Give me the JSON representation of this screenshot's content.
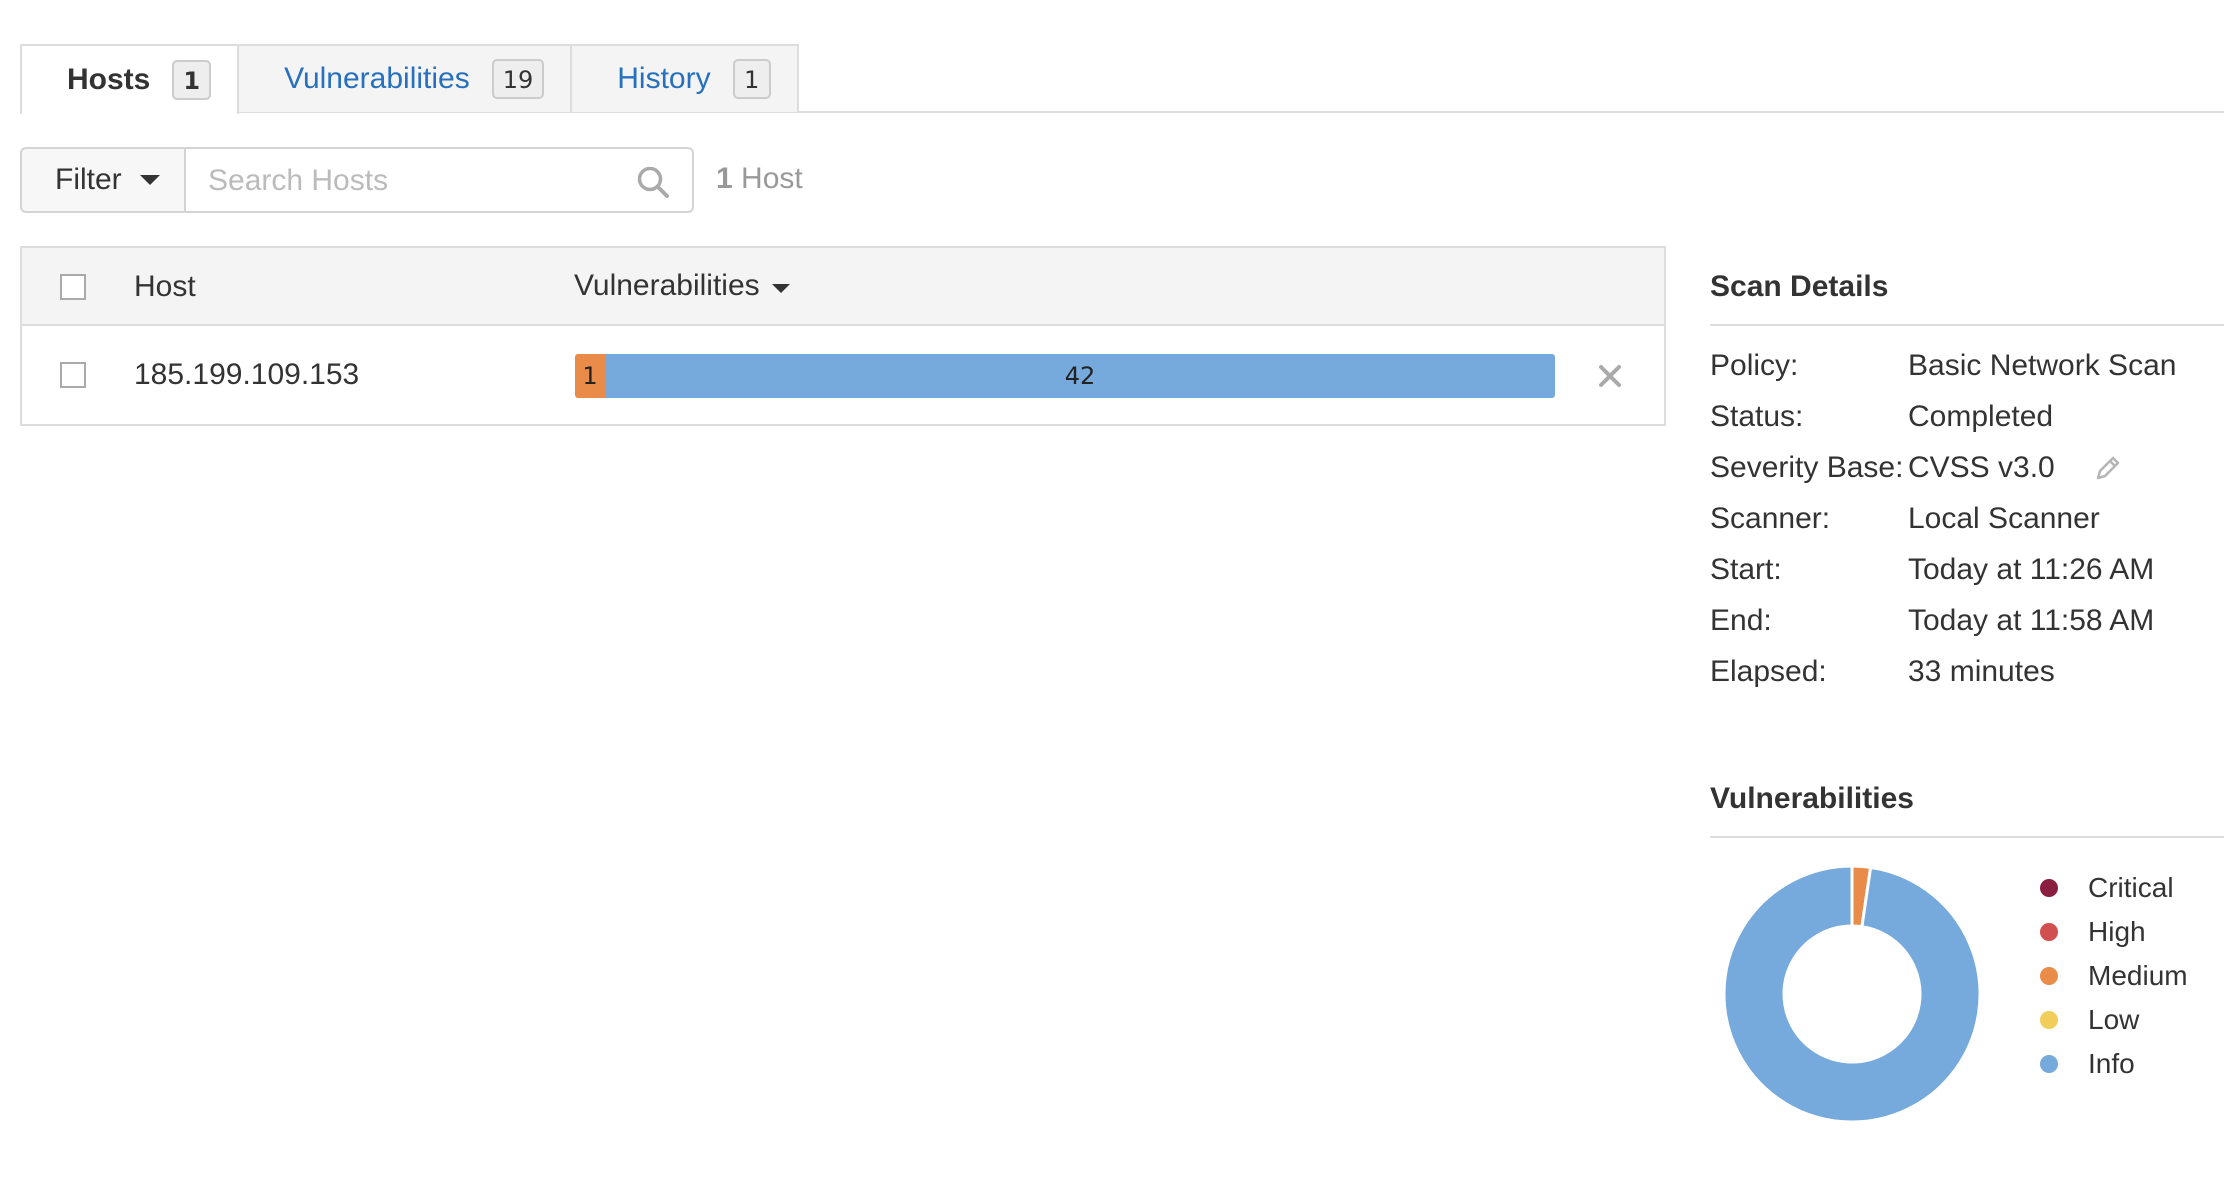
{
  "tabs": [
    {
      "label": "Hosts",
      "count": "1",
      "active": true
    },
    {
      "label": "Vulnerabilities",
      "count": "19",
      "active": false
    },
    {
      "label": "History",
      "count": "1",
      "active": false
    }
  ],
  "toolbar": {
    "filter_label": "Filter",
    "search_placeholder": "Search Hosts",
    "host_count_num": "1",
    "host_count_label": "Host"
  },
  "table": {
    "headers": {
      "host": "Host",
      "vulnerabilities": "Vulnerabilities"
    },
    "rows": [
      {
        "host": "185.199.109.153",
        "bar": [
          {
            "severity": "Medium",
            "count": 1
          },
          {
            "severity": "Info",
            "count": 42
          }
        ]
      }
    ]
  },
  "scan_details": {
    "title": "Scan Details",
    "policy_label": "Policy:",
    "policy": "Basic Network Scan",
    "status_label": "Status:",
    "status": "Completed",
    "severity_label": "Severity Base:",
    "severity": "CVSS v3.0",
    "scanner_label": "Scanner:",
    "scanner": "Local Scanner",
    "start_label": "Start:",
    "start": "Today at 11:26 AM",
    "end_label": "End:",
    "end": "Today at 11:58 AM",
    "elapsed_label": "Elapsed:",
    "elapsed": "33 minutes"
  },
  "vuln_chart": {
    "title": "Vulnerabilities",
    "legend": [
      {
        "label": "Critical",
        "color": "#8b1f3f"
      },
      {
        "label": "High",
        "color": "#d24f4f"
      },
      {
        "label": "Medium",
        "color": "#e98c4a"
      },
      {
        "label": "Low",
        "color": "#f1cd5b"
      },
      {
        "label": "Info",
        "color": "#76aadc"
      }
    ]
  },
  "chart_data": {
    "type": "pie",
    "categories": [
      "Critical",
      "High",
      "Medium",
      "Low",
      "Info"
    ],
    "values": [
      0,
      0,
      1,
      0,
      42
    ],
    "colors": [
      "#8b1f3f",
      "#d24f4f",
      "#e98c4a",
      "#f1cd5b",
      "#76aadc"
    ],
    "title": "Vulnerabilities",
    "legend_position": "right"
  },
  "colors": {
    "accent_link": "#2670bf",
    "medium": "#e98c4a",
    "info": "#76aadc"
  }
}
